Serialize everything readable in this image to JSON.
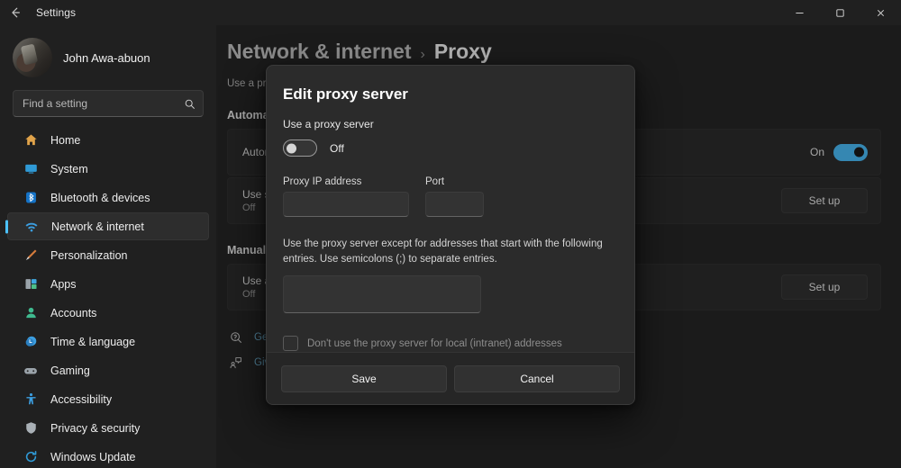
{
  "titlebar": {
    "back_icon": "arrow-left-icon",
    "title": "Settings",
    "minimize_label": "Minimize",
    "maximize_label": "Restore",
    "close_label": "Close"
  },
  "sidebar": {
    "profile": {
      "name": "John Awa-abuon",
      "avatar_name": "user-avatar"
    },
    "search": {
      "placeholder": "Find a setting",
      "value": "",
      "icon": "search-icon"
    },
    "items": [
      {
        "label": "Home",
        "icon": "home-icon",
        "selected": false
      },
      {
        "label": "System",
        "icon": "system-icon",
        "selected": false
      },
      {
        "label": "Bluetooth & devices",
        "icon": "bluetooth-icon",
        "selected": false
      },
      {
        "label": "Network & internet",
        "icon": "network-icon",
        "selected": true
      },
      {
        "label": "Personalization",
        "icon": "personalization-icon",
        "selected": false
      },
      {
        "label": "Apps",
        "icon": "apps-icon",
        "selected": false
      },
      {
        "label": "Accounts",
        "icon": "accounts-icon",
        "selected": false
      },
      {
        "label": "Time & language",
        "icon": "clock-icon",
        "selected": false
      },
      {
        "label": "Gaming",
        "icon": "gamepad-icon",
        "selected": false
      },
      {
        "label": "Accessibility",
        "icon": "accessibility-icon",
        "selected": false
      },
      {
        "label": "Privacy & security",
        "icon": "shield-icon",
        "selected": false
      },
      {
        "label": "Windows Update",
        "icon": "update-icon",
        "selected": false
      }
    ]
  },
  "main": {
    "breadcrumb": {
      "parent": "Network & internet",
      "separator": "›",
      "current": "Proxy"
    },
    "page_description": "Use a proxy server for Ethernet or Wi-Fi connections.",
    "sections": [
      {
        "title": "Automatic proxy setup",
        "rows": [
          {
            "title": "Automatically detect settings",
            "subtitle": "",
            "control": "toggle",
            "state_label": "On",
            "state": "on"
          },
          {
            "title": "Use setup script",
            "subtitle": "Off",
            "control": "button",
            "button_label": "Set up"
          }
        ]
      },
      {
        "title": "Manual proxy setup",
        "rows": [
          {
            "title": "Use a proxy server",
            "subtitle": "Off",
            "control": "button",
            "button_label": "Set up"
          }
        ]
      }
    ],
    "help_links": [
      {
        "label": "Get help",
        "icon": "get-help-icon"
      },
      {
        "label": "Give feedback",
        "icon": "give-feedback-icon"
      }
    ]
  },
  "dialog": {
    "title": "Edit proxy server",
    "toggle_label": "Use a proxy server",
    "toggle_state_label": "Off",
    "toggle_state": "off",
    "ip_label": "Proxy IP address",
    "ip_value": "",
    "ip_placeholder": "",
    "port_label": "Port",
    "port_value": "",
    "port_placeholder": "",
    "exceptions_description": "Use the proxy server except for addresses that start with the following entries. Use semicolons (;) to separate entries.",
    "exceptions_value": "",
    "exceptions_placeholder": "",
    "checkbox_label": "Don't use the proxy server for local (intranet) addresses",
    "checkbox_checked": false,
    "save_label": "Save",
    "cancel_label": "Cancel"
  },
  "colors": {
    "accent": "#4cc2ff",
    "window_bg": "#202020",
    "content_bg": "#272727",
    "card_bg": "#2d2d2d",
    "dialog_bg": "#2b2b2b",
    "link": "#72b7d8"
  }
}
